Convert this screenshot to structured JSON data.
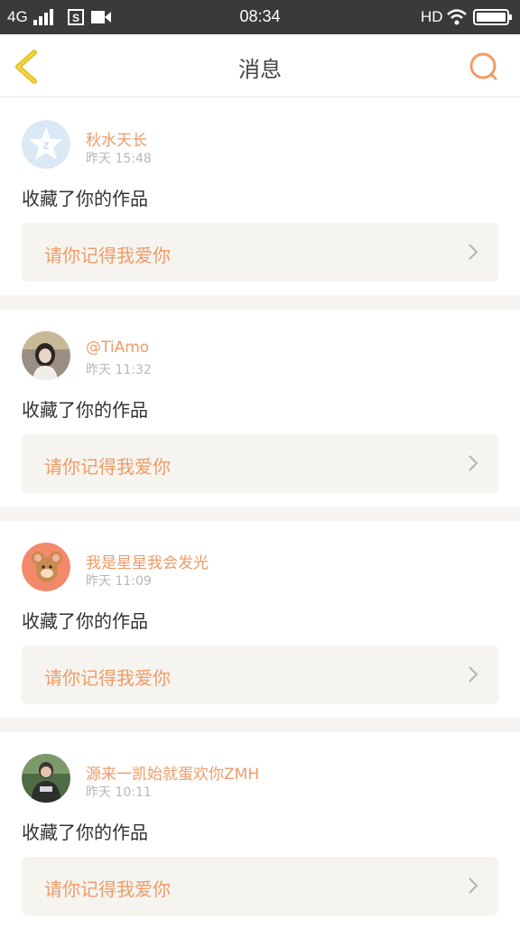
{
  "status_bar": {
    "network": "4G",
    "time": "08:34",
    "hd": "HD"
  },
  "nav": {
    "title": "消息"
  },
  "messages": [
    {
      "name": "秋水天长",
      "time": "昨天 15:48",
      "action": "收藏了你的作品",
      "work": "请你记得我爱你"
    },
    {
      "name": "@TiAmo",
      "time": "昨天 11:32",
      "action": "收藏了你的作品",
      "work": "请你记得我爱你"
    },
    {
      "name": "我是星星我会发光",
      "time": "昨天 11:09",
      "action": "收藏了你的作品",
      "work": "请你记得我爱你"
    },
    {
      "name": "源来一凯始就蛋欢你ZMH",
      "time": "昨天 10:11",
      "action": "收藏了你的作品",
      "work": "请你记得我爱你"
    }
  ],
  "colors": {
    "accent": "#ef9b6a",
    "back_arrow": "#e8c22e",
    "status_bar_bg": "#3a3a3a"
  }
}
